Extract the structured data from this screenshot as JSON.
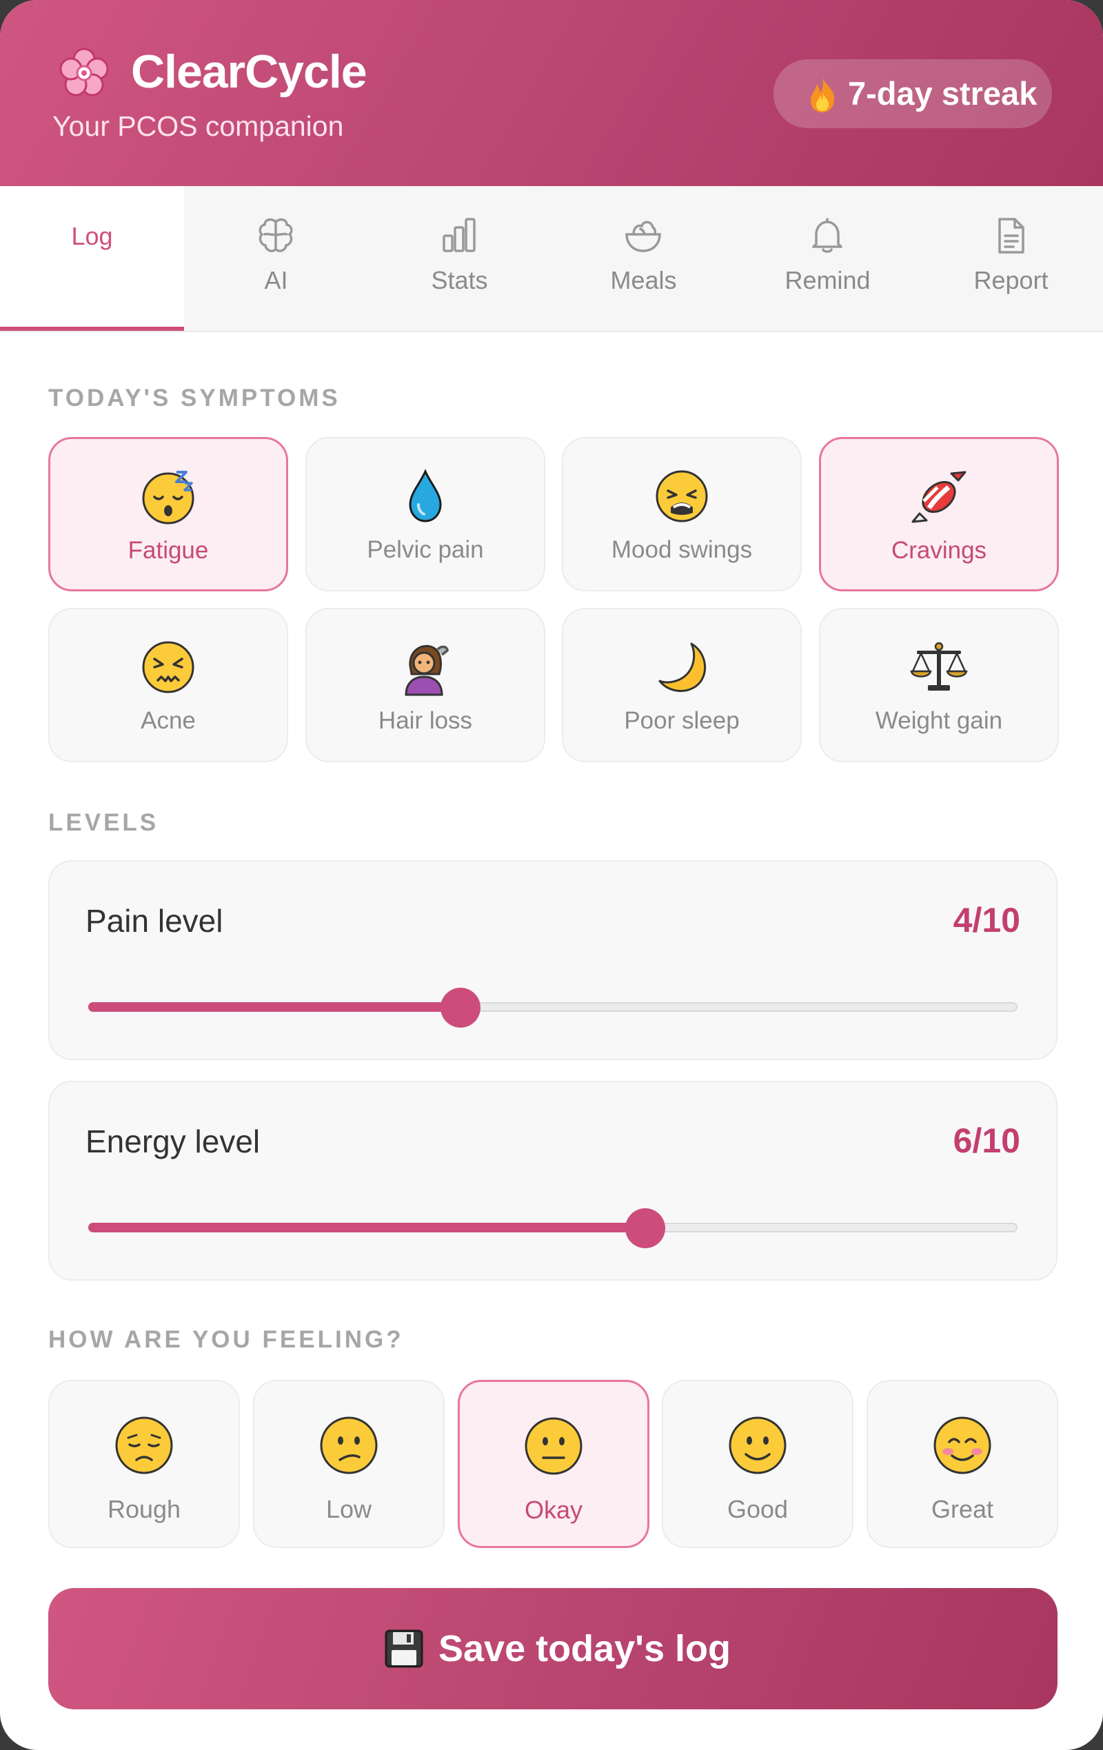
{
  "header": {
    "app_name": "ClearCycle",
    "subtitle": "Your PCOS companion",
    "streak_label": "7-day streak",
    "logo_icon": "cherry-blossom-icon",
    "streak_icon": "flame-icon"
  },
  "tabs": [
    {
      "label": "Log",
      "icon": "none",
      "active": true
    },
    {
      "label": "AI",
      "icon": "brain-icon",
      "active": false
    },
    {
      "label": "Stats",
      "icon": "bar-chart-icon",
      "active": false
    },
    {
      "label": "Meals",
      "icon": "bowl-icon",
      "active": false
    },
    {
      "label": "Remind",
      "icon": "bell-icon",
      "active": false
    },
    {
      "label": "Report",
      "icon": "document-icon",
      "active": false
    }
  ],
  "symptoms": {
    "title": "TODAY'S SYMPTOMS",
    "items": [
      {
        "label": "Fatigue",
        "icon": "sleepy-face-icon",
        "selected": true
      },
      {
        "label": "Pelvic pain",
        "icon": "droplet-icon",
        "selected": false
      },
      {
        "label": "Mood swings",
        "icon": "weary-face-icon",
        "selected": false
      },
      {
        "label": "Cravings",
        "icon": "candy-icon",
        "selected": true
      },
      {
        "label": "Acne",
        "icon": "angry-face-icon",
        "selected": false
      },
      {
        "label": "Hair loss",
        "icon": "woman-hair-icon",
        "selected": false
      },
      {
        "label": "Poor sleep",
        "icon": "crescent-moon-icon",
        "selected": false
      },
      {
        "label": "Weight gain",
        "icon": "balance-scale-icon",
        "selected": false
      }
    ]
  },
  "levels": {
    "title": "LEVELS",
    "pain": {
      "label": "Pain level",
      "value_text": "4/10",
      "value": 4,
      "max": 10
    },
    "energy": {
      "label": "Energy level",
      "value_text": "6/10",
      "value": 6,
      "max": 10
    }
  },
  "feeling": {
    "title": "HOW ARE YOU FEELING?",
    "selected": "Okay",
    "options": [
      {
        "label": "Rough",
        "icon": "pensive-face-icon"
      },
      {
        "label": "Low",
        "icon": "confused-face-icon"
      },
      {
        "label": "Okay",
        "icon": "neutral-face-icon"
      },
      {
        "label": "Good",
        "icon": "slight-smile-icon"
      },
      {
        "label": "Great",
        "icon": "smiling-face-icon"
      }
    ]
  },
  "save_button": {
    "label": "Save today's log",
    "icon": "floppy-disk-icon"
  },
  "colors": {
    "accent": "#cc4d7b",
    "header": "#b6436f",
    "selected_bg": "#fdeef3",
    "selected_border": "#e8769c"
  }
}
